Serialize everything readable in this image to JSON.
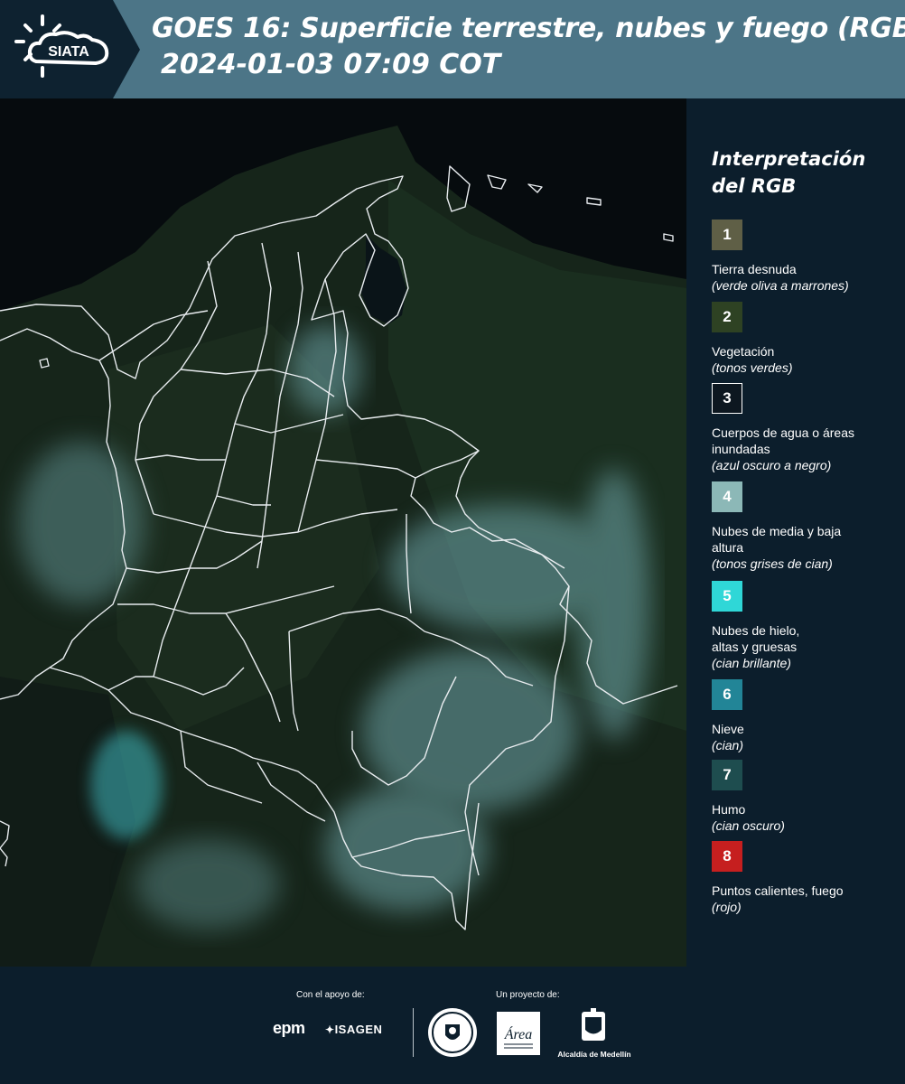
{
  "header": {
    "logo_text": "SIATA",
    "title_line1": "GOES 16: Superficie terrestre, nubes y fuego (RGB)",
    "title_line2": "2024-01-03 07:09 COT"
  },
  "legend": {
    "title": "Interpretación del RGB",
    "items": [
      {
        "number": "1",
        "label": "Tierra desnuda",
        "desc": "(verde oliva a marrones)",
        "color": "#5f5f46"
      },
      {
        "number": "2",
        "label": "Vegetación",
        "desc": "(tonos verdes)",
        "color": "#2e4223"
      },
      {
        "number": "3",
        "label": "Cuerpos de agua o áreas inundadas",
        "desc": "(azul oscuro a negro)",
        "color": "#0d1720"
      },
      {
        "number": "4",
        "label": "Nubes de media y baja altura",
        "desc": "(tonos grises de cian)",
        "color": "#8cb8b7"
      },
      {
        "number": "5",
        "label": "Nubes de hielo, altas y gruesas",
        "desc": "(cian brillante)",
        "color": "#2fd7d7"
      },
      {
        "number": "6",
        "label": "Nieve",
        "desc": "(cian)",
        "color": "#228597"
      },
      {
        "number": "7",
        "label": "Humo",
        "desc": "(cian oscuro)",
        "color": "#1e4d4f"
      },
      {
        "number": "8",
        "label": "Puntos calientes, fuego",
        "desc": "(rojo)",
        "color": "#c61f1f"
      }
    ]
  },
  "footer": {
    "support_label": "Con el apoyo de:",
    "project_label": "Un proyecto de:",
    "epm_text": "epm",
    "isagen_text": "ISAGEN",
    "area_text": "Área",
    "alcaldia_text": "Alcaldía de Medellín"
  },
  "map": {
    "land_color": "#1a2a1c",
    "ocean_color": "#060b0e",
    "border_color": "#e8ecef",
    "cloud_color": "#6fa7ab"
  }
}
